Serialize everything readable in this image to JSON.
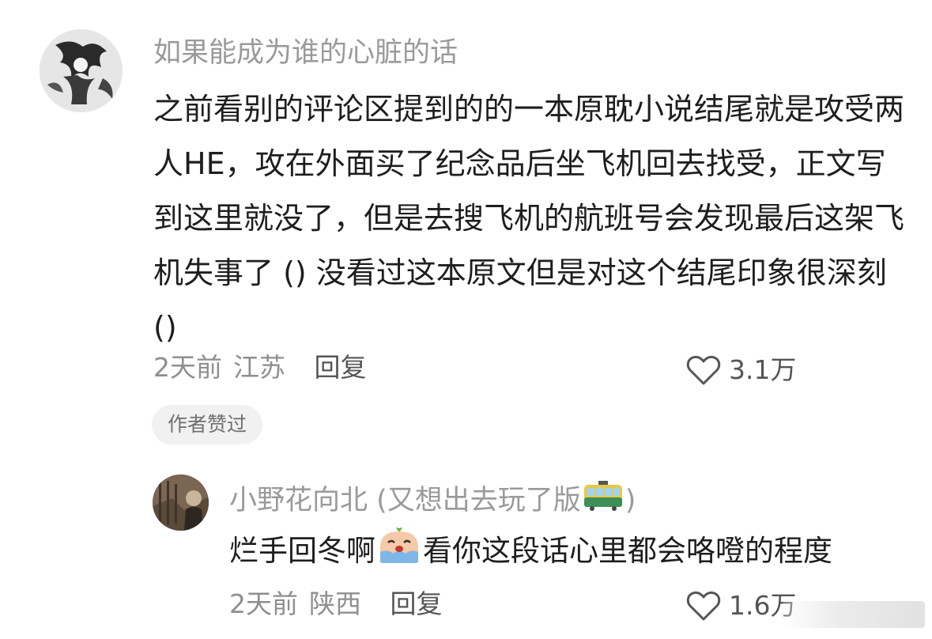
{
  "comment": {
    "username": "如果能成为谁的心脏的话",
    "text": "之前看别的评论区提到的的一本原耽小说结尾就是攻受两人HE，攻在外面买了纪念品后坐飞机回去找受，正文写到这里就没了，但是去搜飞机的航班号会发现最后这架飞机失事了 () 没看过这本原文但是对这个结尾印象很深刻 ()",
    "time": "2天前",
    "location": "江苏",
    "reply_label": "回复",
    "likes": "3.1万",
    "author_liked_badge": "作者赞过"
  },
  "reply": {
    "username_prefix": "小野花向北 (又想出去玩了版",
    "username_suffix": ")",
    "username_emoji": "tram-car-icon",
    "text_before": "烂手回冬啊",
    "text_emoji": "crying-face-icon",
    "text_after": "看你这段话心里都会咯噔的程度",
    "time": "2天前",
    "location": "陕西",
    "reply_label": "回复",
    "likes": "1.6万"
  }
}
